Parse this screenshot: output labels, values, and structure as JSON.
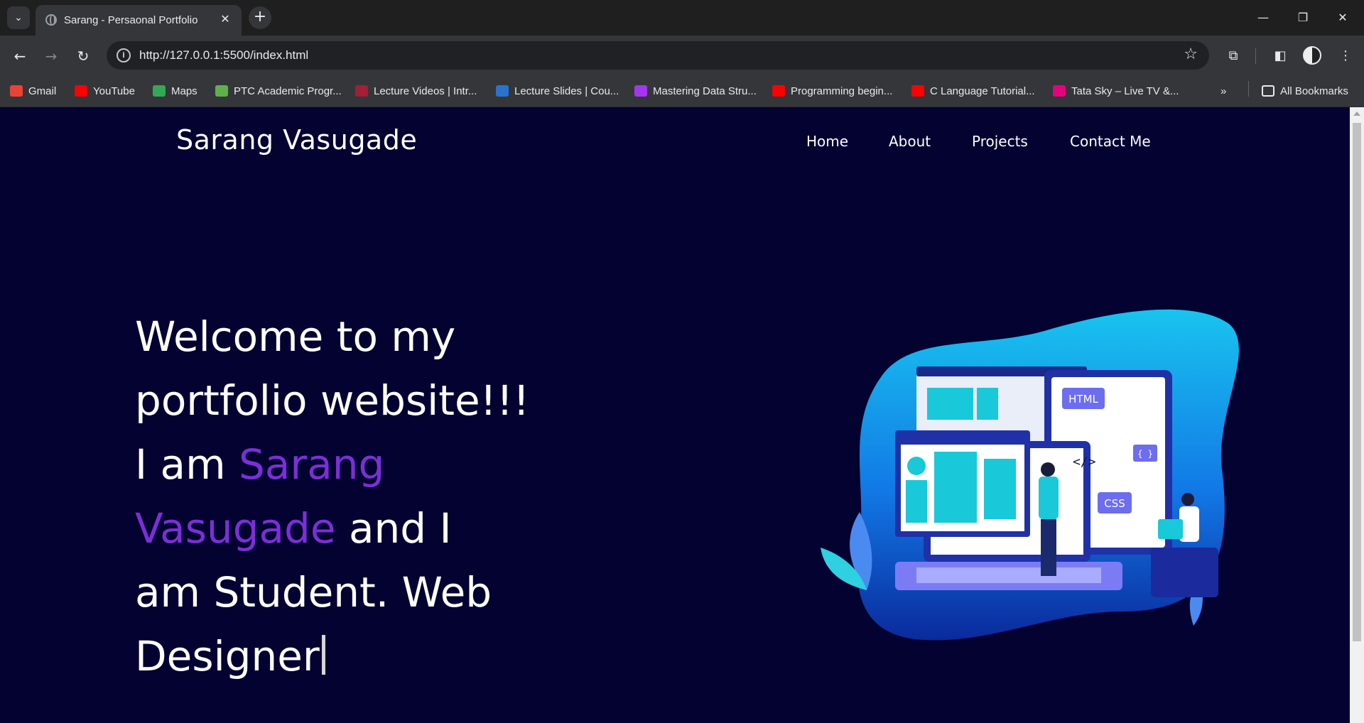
{
  "browser": {
    "tab_title": "Sarang - Persaonal Portfolio",
    "url": "http://127.0.0.1:5500/index.html",
    "bookmarks": [
      {
        "label": "Gmail",
        "icon": "gmail-icon",
        "color": "#ea4335"
      },
      {
        "label": "YouTube",
        "icon": "youtube-icon",
        "color": "#ff0000"
      },
      {
        "label": "Maps",
        "icon": "maps-icon",
        "color": "#34a853"
      },
      {
        "label": "PTC Academic Progr...",
        "icon": "ptc-icon",
        "color": "#5fb04a"
      },
      {
        "label": "Lecture Videos | Intr...",
        "icon": "mit-icon",
        "color": "#a31f34"
      },
      {
        "label": "Lecture Slides | Cou...",
        "icon": "coursera-icon",
        "color": "#2a73cc"
      },
      {
        "label": "Mastering Data Stru...",
        "icon": "udemy-icon",
        "color": "#a435f0"
      },
      {
        "label": "Programming begin...",
        "icon": "youtube-icon",
        "color": "#ff0000"
      },
      {
        "label": "C Language Tutorial...",
        "icon": "youtube-icon",
        "color": "#ff0000"
      },
      {
        "label": "Tata Sky – Live TV &...",
        "icon": "tataplay-icon",
        "color": "#e5007e"
      }
    ],
    "all_bookmarks_label": "All Bookmarks"
  },
  "site": {
    "logo": "Sarang Vasugade",
    "nav": [
      "Home",
      "About",
      "Projects",
      "Contact Me"
    ],
    "hero": {
      "line1": "Welcome to my",
      "line2": "portfolio website!!!",
      "line3_prefix": "I am ",
      "name_part1": "Sarang",
      "name_part2": "Vasugade",
      "line4_suffix": " and I",
      "line5": "am Student. Web",
      "line6": "Designer"
    },
    "illustration": {
      "html_label": "HTML",
      "css_label": "CSS",
      "braces_label": "{ }",
      "code_label": "</>"
    },
    "colors": {
      "background": "#030231",
      "accent": "#7b2fd6",
      "blob": "#0a8fe8"
    }
  }
}
